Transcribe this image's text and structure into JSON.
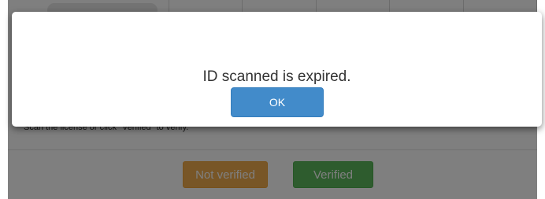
{
  "background_page": {
    "instruction_text": "Scan the license or click \"Verified\" to verify.",
    "buttons": {
      "not_verified_label": "Not verified",
      "verified_label": "Verified"
    }
  },
  "dialog": {
    "message": "ID scanned is expired.",
    "ok_label": "OK"
  },
  "colors": {
    "ok_button": "#428bca",
    "not_verified_button": "#f0ad4e",
    "verified_button": "#5cb85c"
  }
}
